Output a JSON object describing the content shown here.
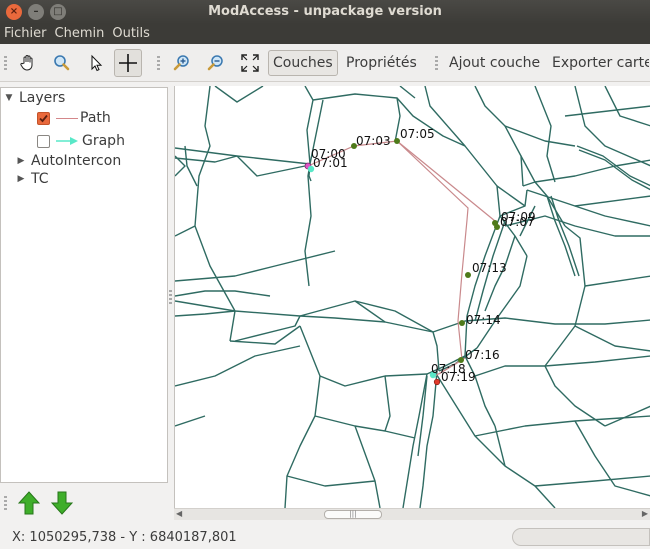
{
  "window": {
    "title": "ModAccess - unpackage version"
  },
  "menubar": {
    "items": [
      "Fichier",
      "Chemin",
      "Outils"
    ]
  },
  "toolbar": {
    "icons": [
      "hand-pan-icon",
      "zoom-area-icon",
      "select-arrow-icon",
      "crosshair-icon",
      "zoom-in-icon",
      "zoom-out-icon",
      "zoom-extent-icon"
    ],
    "couches_label": "Couches",
    "proprietes_label": "Propriétés",
    "ajout_couche_label": "Ajout couche",
    "exporter_label": "Exporter carte"
  },
  "layers": {
    "root": "Layers",
    "items": [
      {
        "label": "Path",
        "checked": true
      },
      {
        "label": "Graph",
        "checked": false
      }
    ],
    "groups": [
      "AutoIntercon",
      "TC"
    ]
  },
  "map": {
    "stop_labels": [
      "07:00",
      "07:01",
      "07:03",
      "07:05",
      "07:09",
      "07:07",
      "07:13",
      "07:14",
      "07:16",
      "07:18",
      "07:19"
    ],
    "colors": {
      "network": "#2f6b62",
      "path": "#c9898c",
      "stop": "#4e7a1a",
      "origin": "#e055c8",
      "destination": "#e03a2a",
      "graph_accent": "#59e8c8"
    }
  },
  "status": {
    "coords": "X: 1050295,738 - Y : 6840187,801"
  }
}
